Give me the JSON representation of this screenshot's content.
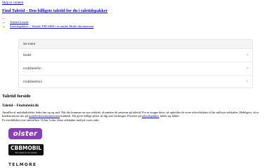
{
  "skip_link": "Skip to content",
  "site_title": "Find Taletid – Den billigste taletid for du i taletidspakker",
  "nav": {
    "toggle": "...",
    "items": [
      {
        "label": "Taletid forside"
      },
      {
        "label": "Sitetidspakker – Taletid, FRI SMS i et samlet Mobil abonnement"
      }
    ]
  },
  "panel": {
    "header": "Se mere",
    "rows": [
      {
        "label": "Mobil"
      },
      {
        "label": "mobiltelefon"
      },
      {
        "label": "mobiltelefoni"
      }
    ]
  },
  "page_title": "Taletid forside",
  "subtitle": "Taletid – Findtaletid.dk",
  "paragraph": {
    "part1": "Ansøller af mobiltaltelefer leder hør op og ned. Når der kommer en nye selskab, så sænker de priserne på taletid. For at stoppe dette, så opholder de store telecelskaber til du mål nye selskaber. Heldigvis, så er konkurrencen stor på ",
    "link1": "mobiltelefonabonnement",
    "part2": " markedt. Du giver billige priser til dig som forbruger. Priserne på ",
    "link2": "taletidspakker",
    "part3": " falder og falder.",
    "line2": "Et overblikket over taletid her: Vi har Loko, disse selskaber med på vores side:"
  },
  "logos": {
    "oister": "oister",
    "cbb": "CBBMOBIL",
    "cbb_tagline": "Så meget for det gamle",
    "telmore": "TELMORE"
  }
}
